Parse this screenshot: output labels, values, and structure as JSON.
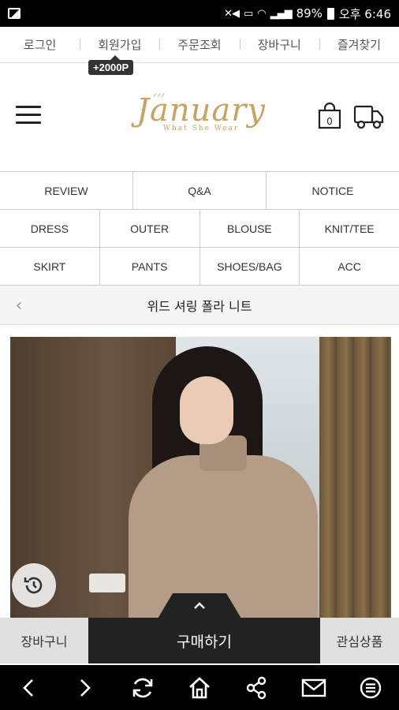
{
  "status_bar": {
    "battery": "89%",
    "time": "오후 6:46"
  },
  "top_links": [
    "로그인",
    "회원가입",
    "주문조회",
    "장바구니",
    "즐겨찾기"
  ],
  "signup_badge": "+2000P",
  "header": {
    "logo_text": "January",
    "logo_tagline": "What She Wear",
    "cart_count": "0"
  },
  "category_menu": {
    "row1": [
      "REVIEW",
      "Q&A",
      "NOTICE"
    ],
    "row2": [
      "DRESS",
      "OUTER",
      "BLOUSE",
      "KNIT/TEE"
    ],
    "row3": [
      "SKIRT",
      "PANTS",
      "SHOES/BAG",
      "ACC"
    ]
  },
  "product": {
    "title": "위드 셔링 폴라 니트"
  },
  "action_bar": {
    "cart_label": "장바구니",
    "buy_label": "구매하기",
    "wish_label": "관심상품"
  },
  "icons": {
    "menu": "hamburger-icon",
    "bag": "shopping-bag-icon",
    "delivery": "truck-icon",
    "back": "chevron-left-icon",
    "history": "history-icon",
    "expand": "chevron-up-icon",
    "nav": [
      "back-arrow-icon",
      "forward-arrow-icon",
      "refresh-icon",
      "home-icon",
      "share-icon",
      "mail-icon",
      "menu-circle-icon"
    ]
  },
  "colors": {
    "logo_gold": "#c8a35f",
    "buy_button": "#222222",
    "secondary_button": "#e0e0e0"
  }
}
